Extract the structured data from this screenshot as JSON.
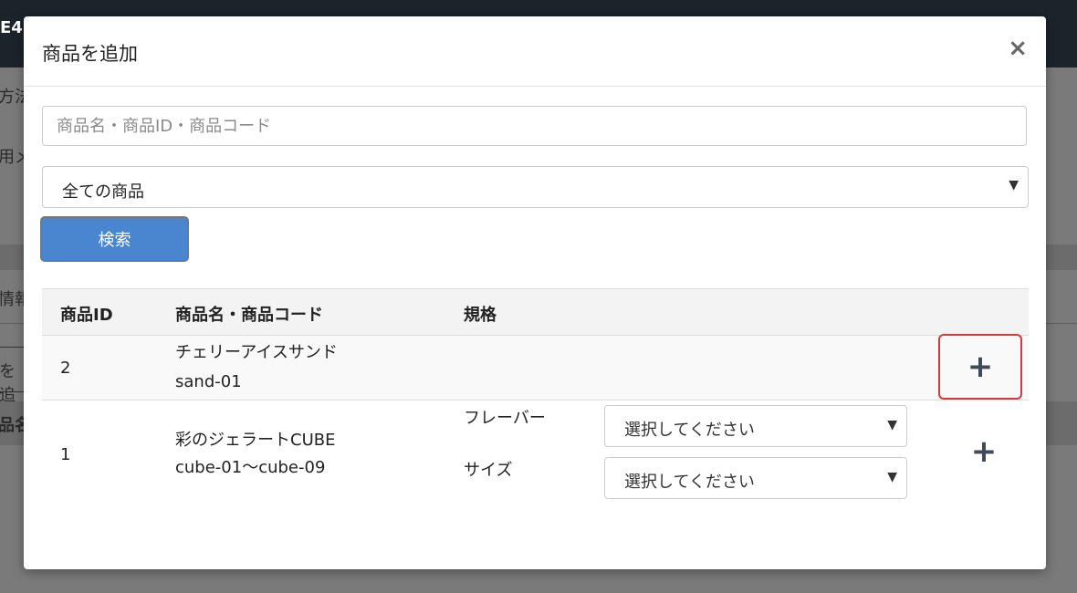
{
  "background": {
    "header_text": "E4",
    "side_texts": [
      "方法",
      "用メ",
      "情報",
      "を追",
      "品名"
    ]
  },
  "modal": {
    "title": "商品を追加",
    "close_icon": "close-icon",
    "search_input": {
      "value": "",
      "placeholder": "商品名・商品ID・商品コード"
    },
    "category_select": {
      "selected": "全ての商品"
    },
    "search_button": "検索",
    "table": {
      "headers": [
        "商品ID",
        "商品名・商品コード",
        "規格"
      ],
      "rows": [
        {
          "id": "2",
          "name": "チェリーアイスサンド",
          "code": "sand-01",
          "options": [],
          "add_icon": "plus-icon"
        },
        {
          "id": "1",
          "name": "彩のジェラートCUBE",
          "code": "cube-01～cube-09",
          "options": [
            {
              "label": "フレーバー",
              "selected": "選択してください"
            },
            {
              "label": "サイズ",
              "selected": "選択してください"
            }
          ],
          "add_icon": "plus-icon"
        }
      ]
    }
  },
  "colors": {
    "primary_button": "#4a86d0",
    "highlight_border": "#d63b3b",
    "header_bg": "#1c232b"
  }
}
